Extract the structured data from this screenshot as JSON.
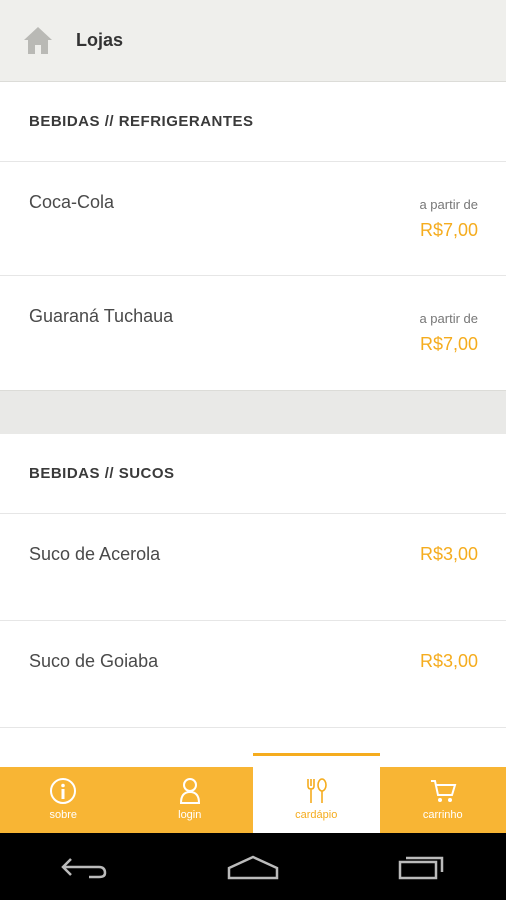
{
  "header": {
    "title": "Lojas",
    "home_icon": "home-icon"
  },
  "sections": [
    {
      "heading_prefix": "BEBIDAS",
      "heading_sep": "//",
      "heading_suffix": "REFRIGERANTES",
      "items": [
        {
          "name": "Coca-Cola",
          "prefix": "a partir de",
          "price": "R$7,00"
        },
        {
          "name": "Guaraná Tuchaua",
          "prefix": "a partir de",
          "price": "R$7,00"
        }
      ]
    },
    {
      "heading_prefix": "BEBIDAS",
      "heading_sep": "//",
      "heading_suffix": "SUCOS",
      "items": [
        {
          "name": "Suco de Acerola",
          "price": "R$3,00"
        },
        {
          "name": "Suco de Goiaba",
          "price": "R$3,00"
        }
      ]
    }
  ],
  "tabs": [
    {
      "label": "sobre",
      "icon": "info-icon"
    },
    {
      "label": "login",
      "icon": "user-icon"
    },
    {
      "label": "cardápio",
      "icon": "fork-spoon-icon"
    },
    {
      "label": "carrinho",
      "icon": "cart-icon"
    }
  ],
  "colors": {
    "accent": "#f8b534",
    "price": "#f5ac1e",
    "nav": "#000000"
  }
}
